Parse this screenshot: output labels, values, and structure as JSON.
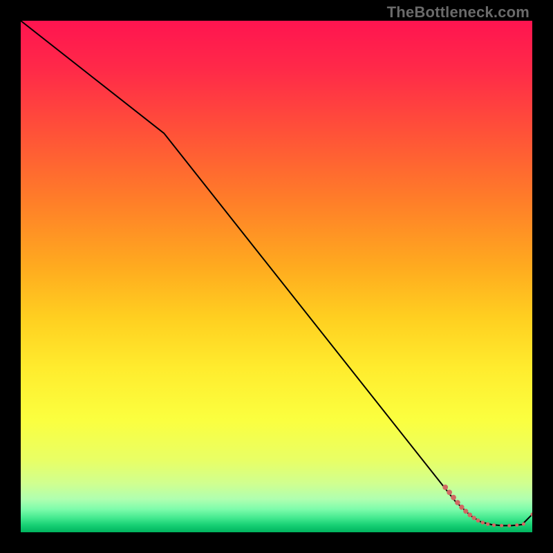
{
  "watermark": "TheBottleneck.com",
  "gradient": {
    "stops": [
      {
        "offset": 0.0,
        "color": "#ff1450"
      },
      {
        "offset": 0.1,
        "color": "#ff2b48"
      },
      {
        "offset": 0.22,
        "color": "#ff5238"
      },
      {
        "offset": 0.35,
        "color": "#ff7d29"
      },
      {
        "offset": 0.48,
        "color": "#ffaa1f"
      },
      {
        "offset": 0.58,
        "color": "#ffcf20"
      },
      {
        "offset": 0.68,
        "color": "#ffec2e"
      },
      {
        "offset": 0.78,
        "color": "#fbff3f"
      },
      {
        "offset": 0.86,
        "color": "#e8ff66"
      },
      {
        "offset": 0.905,
        "color": "#d0ff90"
      },
      {
        "offset": 0.935,
        "color": "#b0ffb0"
      },
      {
        "offset": 0.955,
        "color": "#7dfcab"
      },
      {
        "offset": 0.972,
        "color": "#44e98f"
      },
      {
        "offset": 0.986,
        "color": "#17d074"
      },
      {
        "offset": 1.0,
        "color": "#00b45f"
      }
    ]
  },
  "chart_data": {
    "type": "line",
    "title": "",
    "xlabel": "",
    "ylabel": "",
    "xlim": [
      0,
      100
    ],
    "ylim": [
      0,
      100
    ],
    "series": [
      {
        "name": "main-curve",
        "color": "#000000",
        "width": 2,
        "x": [
          0,
          28,
          85,
          88,
          90,
          92,
          94,
          96,
          98,
          100
        ],
        "y": [
          100,
          78,
          6,
          3.2,
          2.0,
          1.5,
          1.3,
          1.3,
          1.5,
          3.5
        ]
      }
    ],
    "markers": {
      "color": "#cf6a63",
      "points": [
        {
          "x": 83.0,
          "y": 8.8,
          "r": 3.9
        },
        {
          "x": 83.8,
          "y": 7.8,
          "r": 3.9
        },
        {
          "x": 84.6,
          "y": 6.8,
          "r": 3.9
        },
        {
          "x": 85.4,
          "y": 5.8,
          "r": 3.8
        },
        {
          "x": 86.2,
          "y": 4.9,
          "r": 3.7
        },
        {
          "x": 87.0,
          "y": 4.1,
          "r": 3.6
        },
        {
          "x": 87.8,
          "y": 3.4,
          "r": 3.4
        },
        {
          "x": 88.6,
          "y": 2.8,
          "r": 3.2
        },
        {
          "x": 89.4,
          "y": 2.3,
          "r": 3.0
        },
        {
          "x": 90.3,
          "y": 1.9,
          "r": 2.8
        },
        {
          "x": 91.3,
          "y": 1.6,
          "r": 2.7
        },
        {
          "x": 92.5,
          "y": 1.4,
          "r": 2.6
        },
        {
          "x": 94.0,
          "y": 1.3,
          "r": 2.5
        },
        {
          "x": 95.5,
          "y": 1.3,
          "r": 2.5
        },
        {
          "x": 97.0,
          "y": 1.4,
          "r": 2.5
        },
        {
          "x": 98.3,
          "y": 1.6,
          "r": 2.5
        },
        {
          "x": 100.0,
          "y": 3.5,
          "r": 2.6
        }
      ]
    }
  }
}
